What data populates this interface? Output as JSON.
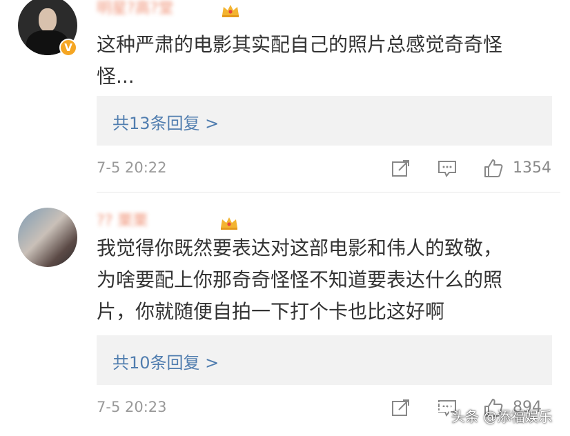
{
  "comments": [
    {
      "username": "明星?高?堂",
      "text_line1": "这种严肃的电影其实配自己的照片总感觉奇奇怪",
      "text_line2": "怪...",
      "replies_label": "共13条回复 >",
      "timestamp": "7-5 20:22",
      "likes": "1354",
      "verified_badge": "V",
      "avatar_icon": "user-avatar",
      "badge_icon": "crown-badge-icon"
    },
    {
      "username": "?? 栗栗",
      "text_line1": "我觉得你既然要表达对这部电影和伟人的致敬，",
      "text_line2": "为啥要配上你那奇奇怪怪不知道要表达什么的照",
      "text_line3": "片，你就随便自拍一下打个卡也比这好啊",
      "replies_label": "共10条回复 >",
      "timestamp": "7-5 20:23",
      "likes": "894",
      "avatar_icon": "user-avatar",
      "badge_icon": "crown-badge-icon"
    }
  ],
  "watermark": {
    "text": "头条 @添福娱乐"
  },
  "colors": {
    "link": "#507daf",
    "username": "#eb7350",
    "meta": "#999999",
    "reply_bg": "#f2f2f2"
  }
}
